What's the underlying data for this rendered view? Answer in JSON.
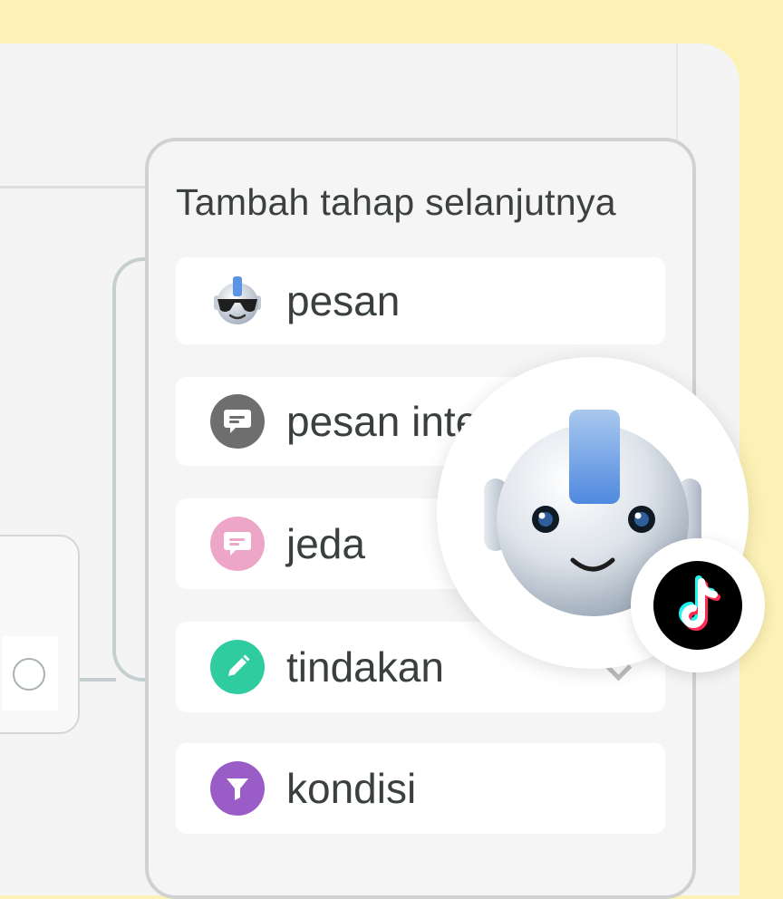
{
  "panel": {
    "title": "Tambah tahap selanjutnya",
    "steps": [
      {
        "label": "pesan",
        "icon": "robot-bot-icon",
        "color": "#ffffff"
      },
      {
        "label": "pesan inte",
        "icon": "chat-bubble-icon",
        "color": "#6e6e6e"
      },
      {
        "label": "jeda",
        "icon": "pause-chat-icon",
        "color": "#eea6c8"
      },
      {
        "label": "tindakan",
        "icon": "pencil-icon",
        "color": "#2fcca0"
      },
      {
        "label": "kondisi",
        "icon": "filter-funnel-icon",
        "color": "#9a5cc6"
      }
    ]
  },
  "colors": {
    "background": "#fdf2b5",
    "canvas": "#f4f4f4",
    "connector": "#c5cfcf",
    "text": "#3c4040"
  },
  "overlay": {
    "robot": "robot-head-icon",
    "badge": "tiktok-logo-icon"
  }
}
